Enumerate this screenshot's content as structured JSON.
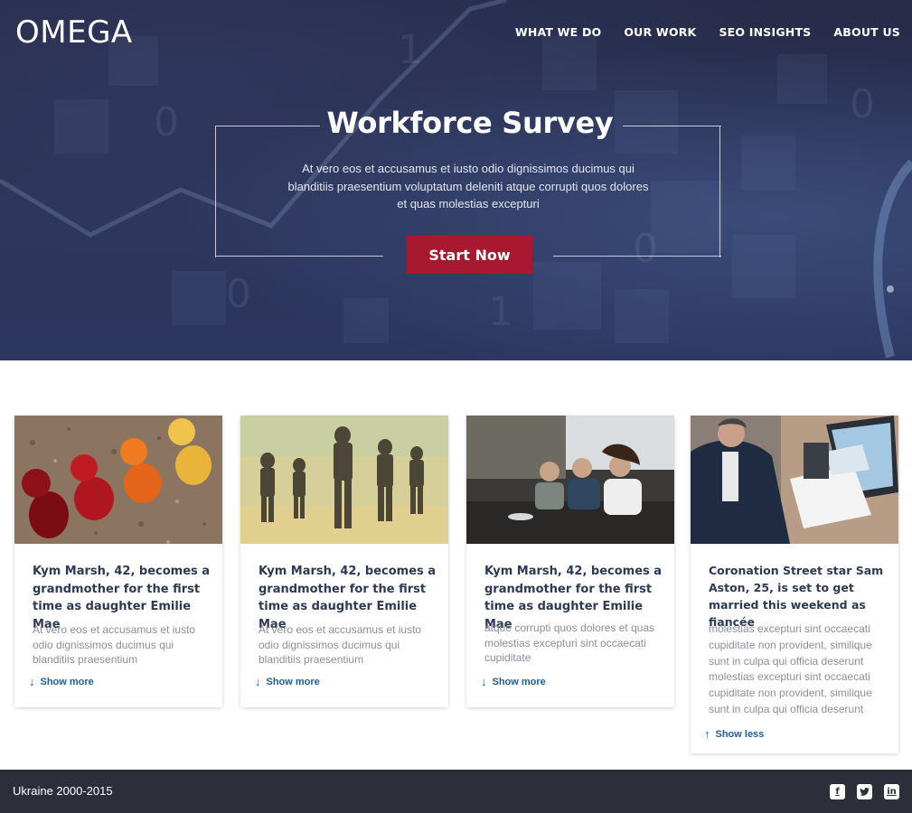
{
  "brand": {
    "logo": "OMEGA"
  },
  "nav": [
    "WHAT WE DO",
    "OUR WORK",
    "SEO INSIGHTS",
    "ABOUT US"
  ],
  "hero": {
    "title": "Workforce Survey",
    "text": "At vero eos et accusamus et iusto odio dignissimos ducimus qui blanditiis praesentium voluptatum deleniti atque corrupti quos dolores et quas molestias excepturi",
    "cta": "Start Now"
  },
  "cards": [
    {
      "image": "red-orange-yellow-game-pawns-photo",
      "title": "Kym Marsh, 42, becomes a grandmother for the first time as daughter Emilie Mae",
      "body": "At vero eos et accusamus et iusto odio dignissimos ducimus qui blanditiis praesentium",
      "link": "Show more"
    },
    {
      "image": "soldiers-walking-in-desert-photo",
      "title": "Kym Marsh, 42, becomes a grandmother for the first time as daughter Emilie Mae",
      "body": "At vero eos et accusamus et iusto odio dignissimos ducimus qui blanditiis praesentium",
      "link": "Show more"
    },
    {
      "image": "people-talking-in-office-photo",
      "title": "Kym Marsh, 42, becomes a grandmother for the first time as daughter Emilie Mae",
      "body": "atque corrupti quos dolores et quas molestias excepturi sint occaecati cupiditate",
      "link": "Show more"
    },
    {
      "image": "man-with-documents-and-laptop-photo",
      "title": "Coronation Street star Sam Aston, 25, is set to get married this weekend as fiancée",
      "body": "molestias excepturi sint occaecati cupiditate non provident, similique sunt in culpa qui officia deserunt molestias excepturi sint occaecati cupiditate non provident, similique sunt in culpa qui officia deserunt",
      "link": "Show less"
    }
  ],
  "footer": {
    "text": "Ukraine 2000-2015",
    "socials": [
      "facebook-icon",
      "twitter-icon",
      "linkedin-icon"
    ]
  },
  "colors": {
    "hero_bg": "#2b3356",
    "cta": "#a8192f",
    "card_title": "#2e3a55",
    "link": "#1f5d9e",
    "footer_bg": "#2c2f39"
  }
}
